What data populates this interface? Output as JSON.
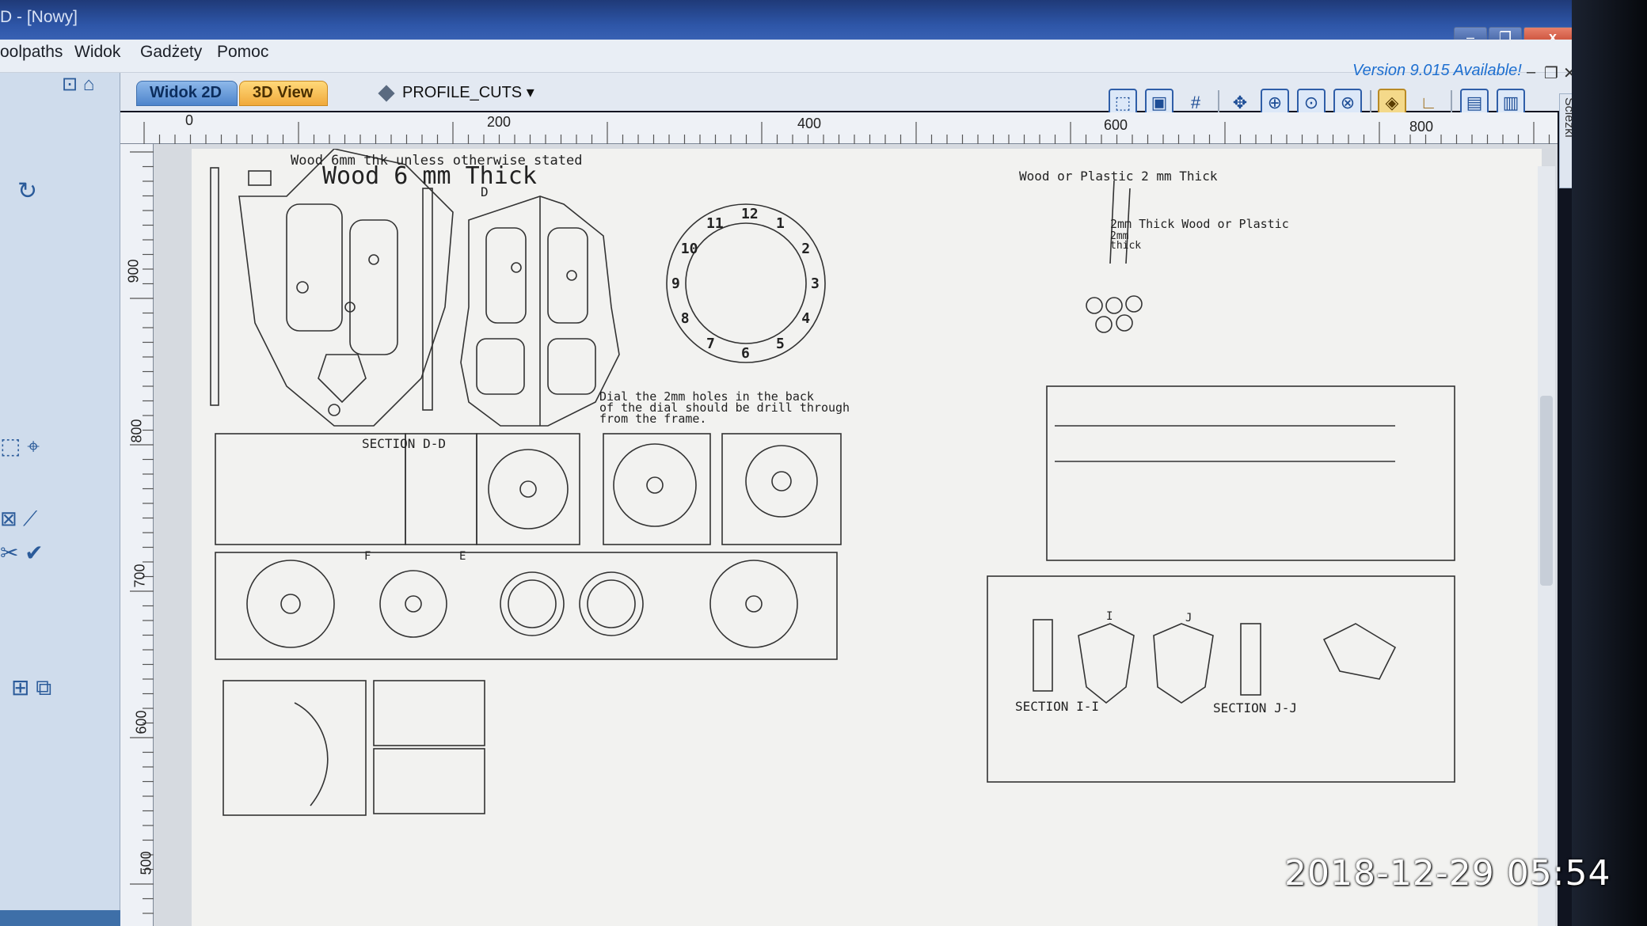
{
  "window": {
    "title": "D - [Nowy]",
    "controls": {
      "minimize": "–",
      "maximize": "❐",
      "close": "x"
    }
  },
  "menu": {
    "items": [
      "oolpaths",
      "Widok",
      "Gadżety",
      "Pomoc"
    ]
  },
  "version_notice": "Version 9.015 Available!",
  "view_tabs": {
    "tab_2d": "Widok 2D",
    "tab_3d": "3D View"
  },
  "layer": {
    "name": "PROFILE_CUTS",
    "arrow": "▾"
  },
  "side_tab": "Ścieżki",
  "ruler": {
    "top_labels": [
      "0",
      "200",
      "400",
      "600",
      "800"
    ],
    "left_labels": [
      "900",
      "800",
      "700",
      "600",
      "500"
    ]
  },
  "toolbar": {
    "icons": [
      "select-frame-icon",
      "image-view-icon",
      "grid-icon",
      "pan-icon",
      "zoom-in-icon",
      "zoom-fit-icon",
      "zoom-extents-icon",
      "snap-icon",
      "measure-icon",
      "layout-icon",
      "split-view-icon"
    ]
  },
  "drawing": {
    "header_small": "Wood 6mm thk unless otherwise stated",
    "header_large": "Wood 6 mm Thick",
    "section_dd": "SECTION D-D",
    "marker_d": "D",
    "dial_note_1": "Dial the 2mm holes in the back",
    "dial_note_2": "of the dial should be drill through",
    "dial_note_3": "from the frame.",
    "right_header": "Wood or Plastic 2 mm Thick",
    "right_note_1": "2mm Thick Wood or Plastic",
    "right_note_2": "2mm",
    "right_note_3": "thick",
    "section_ii": "SECTION I-I",
    "section_jj": "SECTION J-J",
    "marker_e": "E",
    "marker_f": "F",
    "marker_i": "I",
    "marker_j": "J",
    "dial_numbers": [
      "12",
      "1",
      "2",
      "3",
      "4",
      "5",
      "6",
      "7",
      "8",
      "9",
      "10",
      "11"
    ]
  },
  "timestamp": "2018-12-29 05:54"
}
